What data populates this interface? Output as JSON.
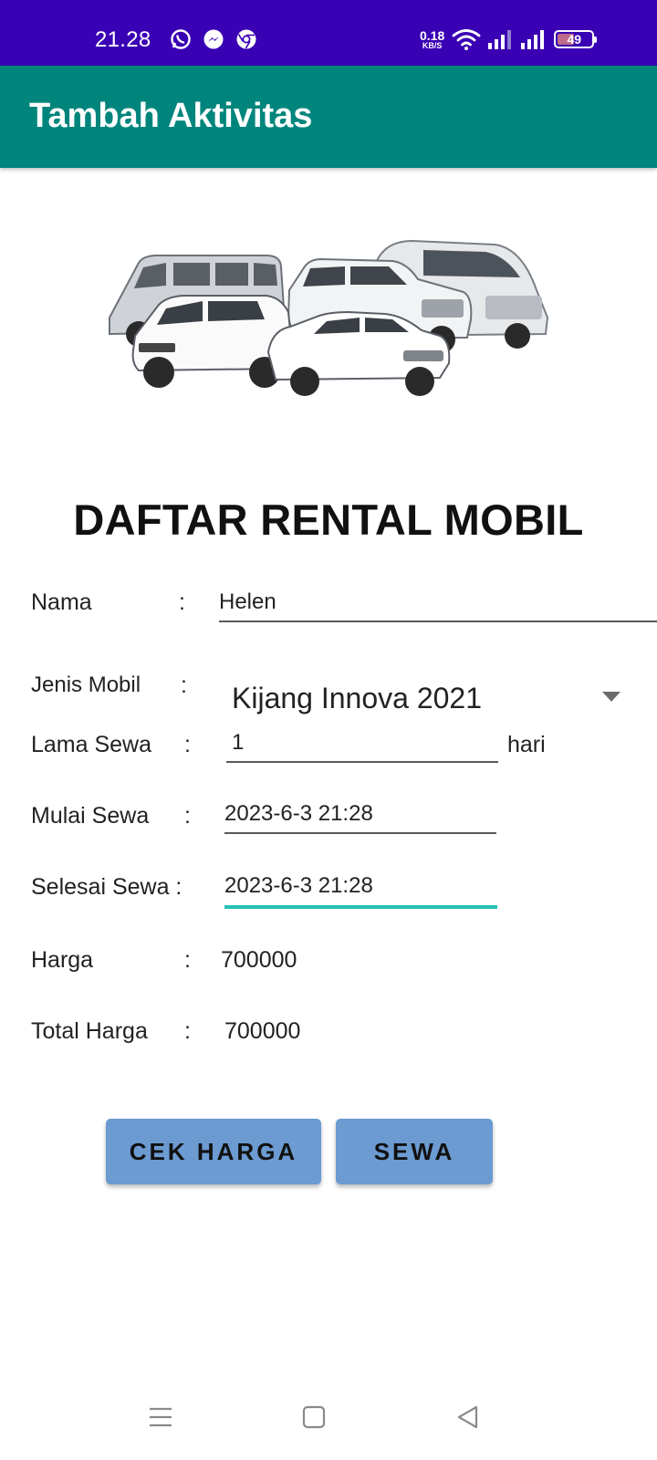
{
  "status_bar": {
    "time": "21.28",
    "net_speed_value": "0.18",
    "net_speed_unit": "KB/S",
    "battery_level": "49",
    "icons": [
      "whatsapp-icon",
      "messenger-icon",
      "chrome-icon",
      "wifi-icon",
      "signal-icon",
      "signal-icon",
      "battery-icon"
    ]
  },
  "app_bar": {
    "title": "Tambah Aktivitas"
  },
  "colors": {
    "status_bar": "#3a00b4",
    "app_bar": "#00857d",
    "button": "#6b9bd1",
    "focus_line": "#26c2b6"
  },
  "form": {
    "heading": "DAFTAR RENTAL MOBIL",
    "colon": ":",
    "nama": {
      "label": "Nama",
      "value": "Helen"
    },
    "jenis_mobil": {
      "label": "Jenis Mobil",
      "value": "Kijang Innova 2021"
    },
    "lama_sewa": {
      "label": "Lama Sewa",
      "value": "1",
      "unit": "hari"
    },
    "mulai_sewa": {
      "label": "Mulai Sewa",
      "value": "2023-6-3 21:28"
    },
    "selesai_sewa": {
      "label": "Selesai Sewa :",
      "value": "2023-6-3 21:28"
    },
    "harga": {
      "label": "Harga",
      "value": "700000"
    },
    "total_harga": {
      "label": "Total Harga",
      "value": "700000"
    }
  },
  "buttons": {
    "cek_harga": "CEK HARGA",
    "sewa": "SEWA"
  },
  "nav_bar": {
    "icons": [
      "menu-icon",
      "home-icon",
      "back-icon"
    ]
  }
}
